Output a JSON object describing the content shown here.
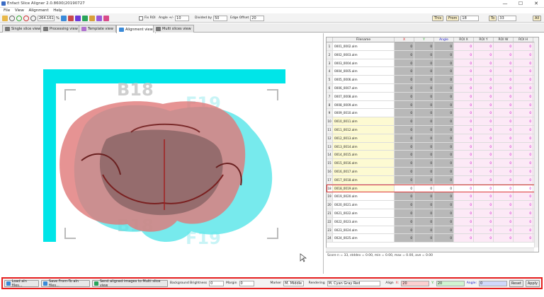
{
  "window": {
    "title": "Enfact Slice Aligner 2.0.8600(20190727",
    "minimize": "—",
    "maximize": "☐",
    "close": "✕"
  },
  "menu": [
    "File",
    "View",
    "Alignment",
    "Help"
  ],
  "toolbar": {
    "zoom_value": "264.161",
    "fix_roi_label": "Fix ROI",
    "angle_label": "Angle +/-",
    "angle_value": "10",
    "divided_label": "Divided by",
    "divided_value": "50",
    "edge_label": "Edge Offset",
    "edge_value": "20",
    "this_label": "This",
    "from_label": "From",
    "from_value": "18",
    "to_label": "To",
    "to_value": "33",
    "all_label": "All"
  },
  "tabs": [
    {
      "label": "Single slice view",
      "active": false
    },
    {
      "label": "Processing view",
      "active": false
    },
    {
      "label": "Template view",
      "active": false
    },
    {
      "label": "Alignment view",
      "active": true
    },
    {
      "label": "Multi slices view",
      "active": false
    }
  ],
  "image": {
    "label_top_left": "B18",
    "label_top_right": "F19",
    "label_bottom_left": "B18",
    "label_bottom_right": "F19"
  },
  "grid": {
    "headers": [
      "",
      "Filename",
      "X",
      "Y",
      "Angle",
      "ROI X",
      "ROI Y",
      "ROI W",
      "ROI H",
      "Score"
    ],
    "header_colors": [
      "#222",
      "#222",
      "#d22",
      "#2a2",
      "#22c",
      "#222",
      "#222",
      "#222",
      "#222",
      "#222"
    ],
    "highlight_row": 18,
    "yellow_from": 10,
    "yellow_to": 18,
    "rows": [
      "0001_0002.alm",
      "0002_0003.alm",
      "0003_0004.alm",
      "0004_0005.alm",
      "0005_0006.alm",
      "0006_0007.alm",
      "0007_0008.alm",
      "0008_0009.alm",
      "0009_0010.alm",
      "0010_0011.alm",
      "0011_0012.alm",
      "0012_0013.alm",
      "0013_0014.alm",
      "0014_0015.alm",
      "0015_0016.alm",
      "0016_0017.alm",
      "0017_0018.alm",
      "0018_0019.alm",
      "0019_0020.alm",
      "0020_0021.alm",
      "0021_0022.alm",
      "0022_0023.alm",
      "0023_0024.alm",
      "0024_0025.alm"
    ],
    "cell_value": "0"
  },
  "status": "Score n = 33, stddev = 0.00, min = 0.00, max = 0.00, ave = 0.00",
  "bottom": {
    "load_label": "Load aln files...",
    "save_label": "Save From-To aln files...",
    "send_label": "Send aligned images to Multi slice view",
    "bg_label": "Background Brightness",
    "bg_value": "0",
    "margin_label": "Margin",
    "margin_value": "0",
    "marker_label": "Marker",
    "marker_value": "M. Middle",
    "rendering_label": "Rendering",
    "rendering_value": "M. Cyan Gray Red",
    "align_label": "Align",
    "x_label": "X:",
    "x_value": "20",
    "y_label": "Y:",
    "y_value": "20",
    "angle_label": "Angle:",
    "angle_value": "0",
    "reset_label": "Reset",
    "apply_label": "Apply"
  },
  "colors": {
    "cyan": "#00e5e8",
    "red": "#e03030",
    "highlight": "#e52020"
  }
}
